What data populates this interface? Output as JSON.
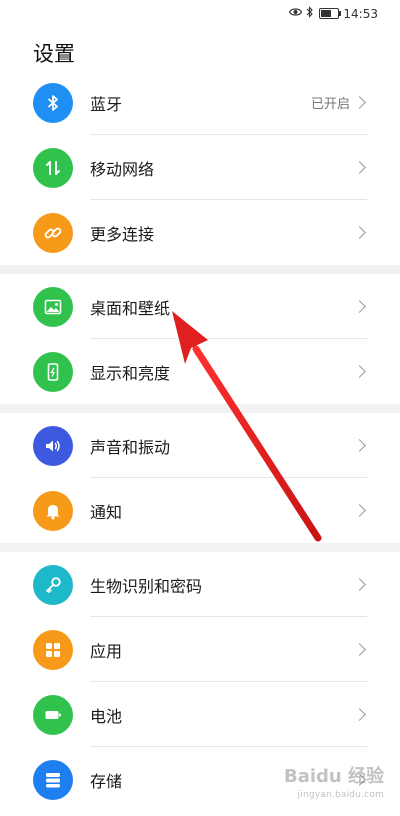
{
  "status_bar": {
    "time": "14:53",
    "icons": [
      "eye-icon",
      "bluetooth-icon",
      "battery-icon"
    ]
  },
  "title": "设置",
  "colors": {
    "bluetooth": "#1f8ff4",
    "mobile_network": "#31c24e",
    "more_connections": "#f79a1a",
    "desktop_wallpaper": "#31c24e",
    "display": "#31c24e",
    "sound": "#3d59e0",
    "notification": "#f79a1a",
    "biometrics": "#1db8c9",
    "apps": "#f79a1a",
    "battery": "#31c24e",
    "storage": "#1f7ff0",
    "arrow": "#e02020"
  },
  "items": [
    {
      "label": "蓝牙",
      "value": "已开启",
      "icon": "bluetooth-icon"
    },
    {
      "label": "移动网络",
      "value": "",
      "icon": "mobile-data-icon"
    },
    {
      "label": "更多连接",
      "value": "",
      "icon": "link-icon"
    },
    {
      "label": "桌面和壁纸",
      "value": "",
      "icon": "image-icon"
    },
    {
      "label": "显示和亮度",
      "value": "",
      "icon": "phone-display-icon"
    },
    {
      "label": "声音和振动",
      "value": "",
      "icon": "speaker-icon"
    },
    {
      "label": "通知",
      "value": "",
      "icon": "bell-icon"
    },
    {
      "label": "生物识别和密码",
      "value": "",
      "icon": "key-icon"
    },
    {
      "label": "应用",
      "value": "",
      "icon": "apps-grid-icon"
    },
    {
      "label": "电池",
      "value": "",
      "icon": "battery-icon"
    },
    {
      "label": "存储",
      "value": "",
      "icon": "storage-icon"
    }
  ],
  "watermark": {
    "text": "Baidu 经验",
    "sub": "jingyan.baidu.com"
  }
}
